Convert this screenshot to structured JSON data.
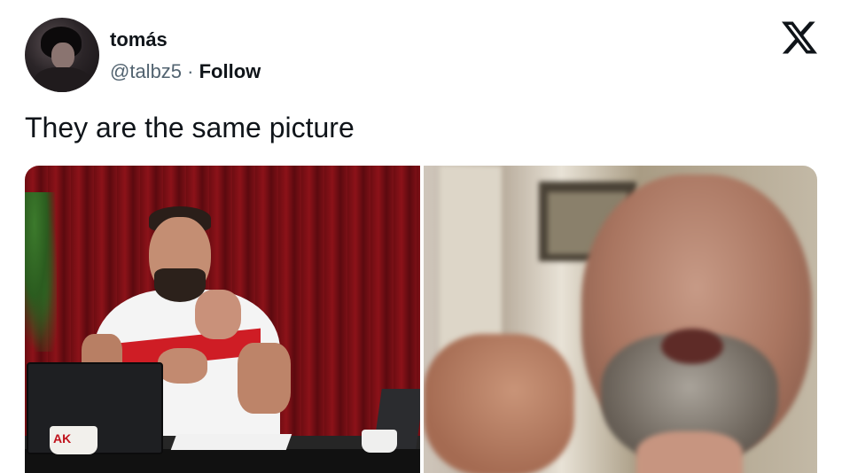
{
  "author": {
    "name": "tomás",
    "handle": "@talbz5",
    "separator": " · ",
    "follow_label": "Follow"
  },
  "icons": {
    "avatar": "profile-avatar",
    "logo": "x-logo-icon"
  },
  "tweet": {
    "text": "They are the same picture"
  },
  "media": {
    "left_image": {
      "mug_text": "AK"
    },
    "right_image": {}
  },
  "colors": {
    "text": "#0f1419",
    "secondary_text": "#536471",
    "background": "#ffffff"
  }
}
